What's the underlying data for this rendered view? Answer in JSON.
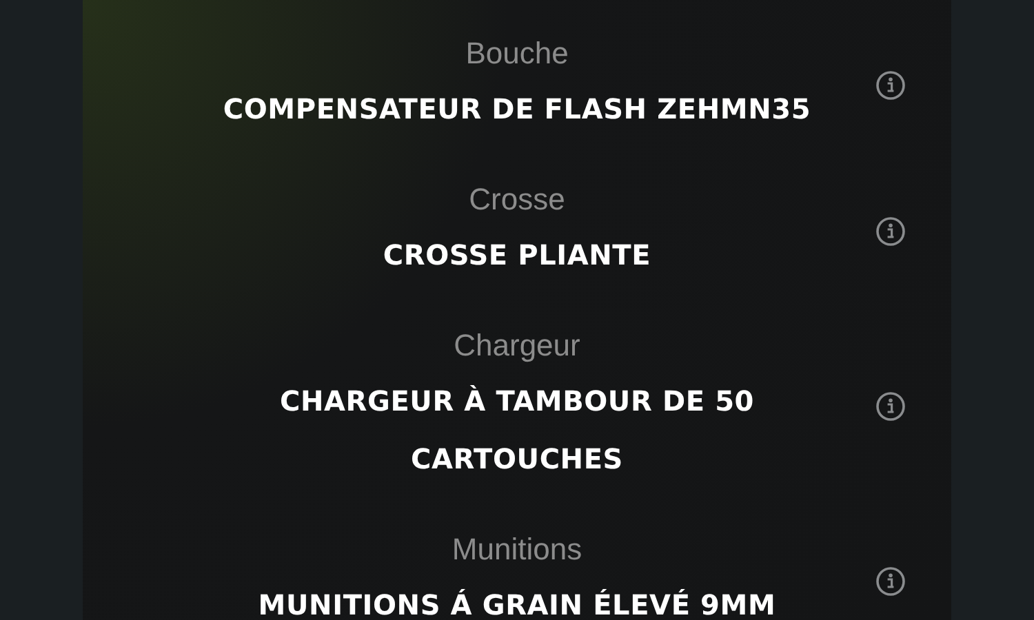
{
  "attachments": [
    {
      "label": "Bouche",
      "value": "COMPENSATEUR DE FLASH ZEHMN35"
    },
    {
      "label": "Crosse",
      "value": "CROSSE PLIANTE"
    },
    {
      "label": "Chargeur",
      "value": "CHARGEUR À TAMBOUR DE 50 CARTOUCHES"
    },
    {
      "label": "Munitions",
      "value": "MUNITIONS Á GRAIN ÉLEVÉ 9MM"
    }
  ]
}
